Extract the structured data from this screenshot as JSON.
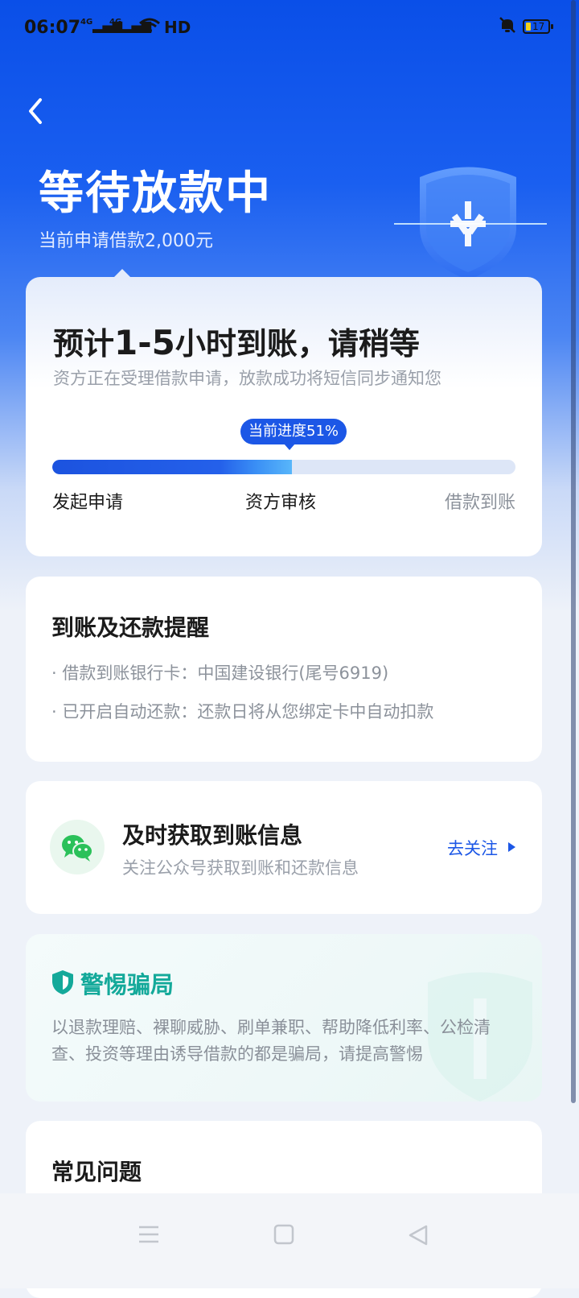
{
  "status_bar": {
    "time": "06:07",
    "sig1": "4G",
    "sig2": "4G",
    "hd": "HD",
    "battery": "17"
  },
  "header": {
    "title": "等待放款中",
    "subtitle": "当前申请借款2,000元"
  },
  "progress_card": {
    "heading_pre": "预计",
    "heading_num": "1-5",
    "heading_post": "小时到账，请稍等",
    "description": "资方正在受理借款申请，放款成功将短信同步通知您",
    "progress_label": "当前进度51%",
    "progress_fraction": 0.517,
    "steps": [
      "发起申请",
      "资方审核",
      "借款到账"
    ]
  },
  "reminder_card": {
    "title": "到账及还款提醒",
    "items": [
      "· 借款到账银行卡：中国建设银行(尾号6919)",
      "· 已开启自动还款：还款日将从您绑定卡中自动扣款"
    ]
  },
  "wechat_card": {
    "title": "及时获取到账信息",
    "subtitle": "关注公众号获取到账和还款信息",
    "action": "去关注"
  },
  "fraud_card": {
    "title": "警惕骗局",
    "body": "以退款理赔、裸聊威胁、刷单兼职、帮助降低利率、公检清查、投资等理由诱导借款的都是骗局，请提高警惕"
  },
  "faq_card": {
    "title": "常见问题"
  },
  "colors": {
    "primary": "#1c57e6",
    "accent_green": "#14a99a",
    "wechat_green": "#2bc15a"
  }
}
